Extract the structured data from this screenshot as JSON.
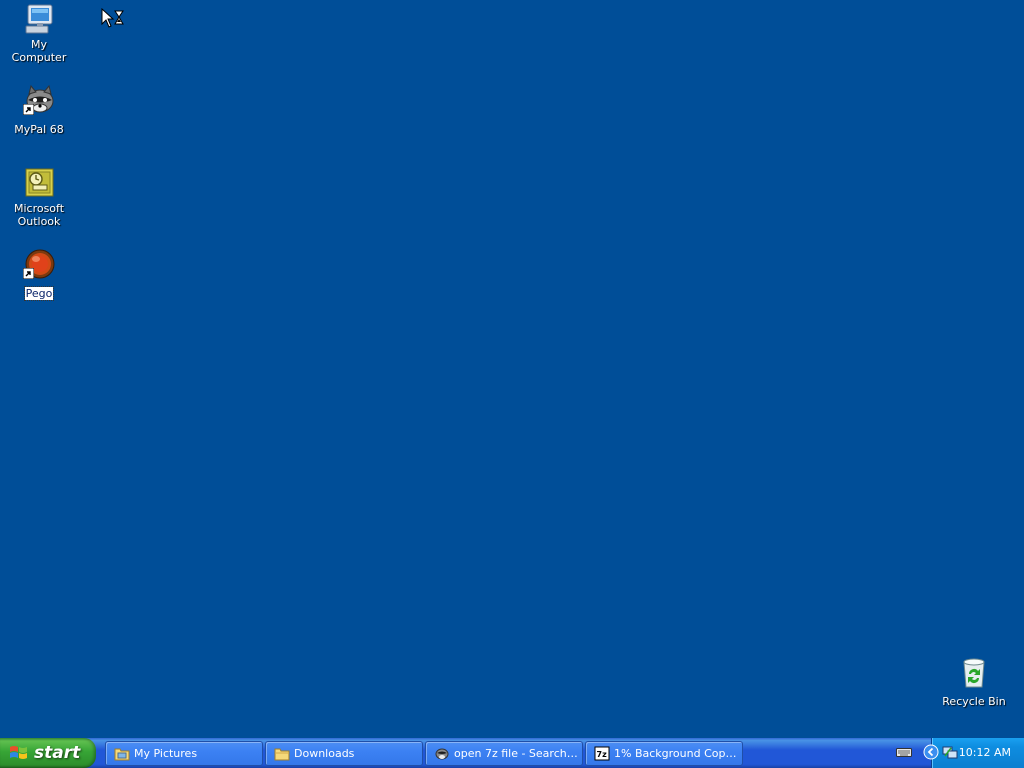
{
  "desktop": {
    "icons": [
      {
        "label": "My Computer",
        "icon": "my-computer-icon"
      },
      {
        "label": "MyPal 68",
        "icon": "mypal-icon"
      },
      {
        "label": "Microsoft Outlook",
        "icon": "outlook-icon"
      },
      {
        "label": "Pego",
        "icon": "pego-icon",
        "selected": true
      },
      {
        "label": "Recycle Bin",
        "icon": "recycle-bin-icon"
      }
    ]
  },
  "taskbar": {
    "start_label": "start",
    "tasks": [
      {
        "label": "My Pictures",
        "icon": "folder-pictures-icon"
      },
      {
        "label": "Downloads",
        "icon": "folder-icon"
      },
      {
        "label": "open 7z file - Search ...",
        "icon": "mypal-icon"
      },
      {
        "label": "1% Background Copy...",
        "icon": "7zip-icon"
      }
    ],
    "clock": "10:12 AM"
  },
  "colors": {
    "desktop": "#004e98",
    "taskbar": "#2157d7",
    "start": "#37a536",
    "tray": "#0c7fd0"
  }
}
